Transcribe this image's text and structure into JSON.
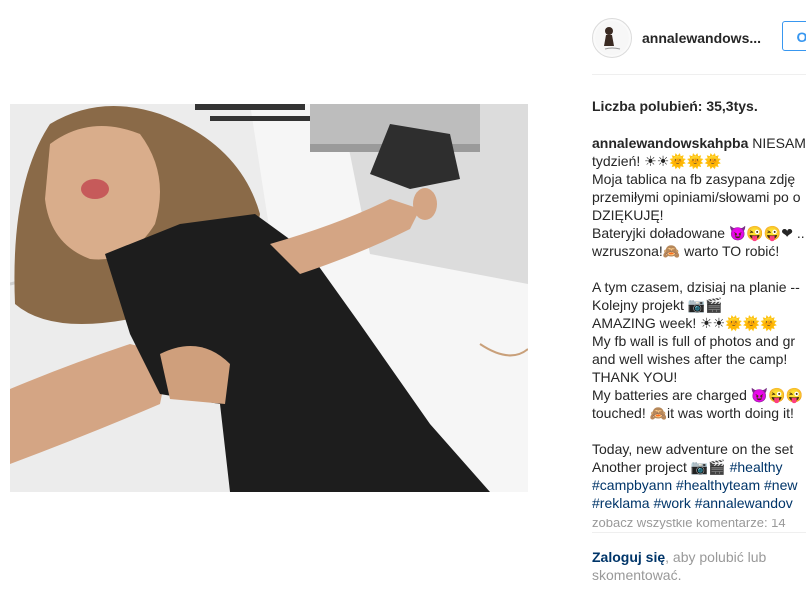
{
  "post": {
    "username": "annalewandows...",
    "follow_label": "O",
    "likes_text": "Liczba polubień: 35,3tys."
  },
  "caption": {
    "author": "annalewandowskahpba",
    "lines": {
      "l1": "NIESAM",
      "l2": "tydzień! ☀☀🌞🌞🌞",
      "l3": "Moja tablica na fb zasypana zdję",
      "l4": "przemiłymi opiniami/słowami po o",
      "l5": "DZIĘKUJĘ!",
      "l6": "Baterуjki doładowane 😈😜😜❤ ..",
      "l7": "wzruszona!🙈 warto TO robić!",
      "l8": "A tym czasem, dzisiaj na planie --",
      "l9": "Kolejny projekt 📷🎬",
      "l10": "AMAZING week! ☀☀🌞🌞🌞",
      "l11": "My fb wall is full of photos and gr",
      "l12": "and well wishes after the camp!",
      "l13": "THANK YOU!",
      "l14": "My batteries are charged 😈😜😜",
      "l15": "touched! 🙈it was worth doing it!",
      "l16": "Today, new adventure on the set",
      "l17a": "Another project 📷🎬",
      "l17b": "#healthy",
      "l18": "#campbyann #healthyteam #new",
      "l19": "#reklama #work #annalewandov"
    }
  },
  "more_comments": "zobacz wszystkie komentarze: 14",
  "login": {
    "link": "Zaloguj się",
    "rest": ", aby polubić lub skomentować."
  }
}
